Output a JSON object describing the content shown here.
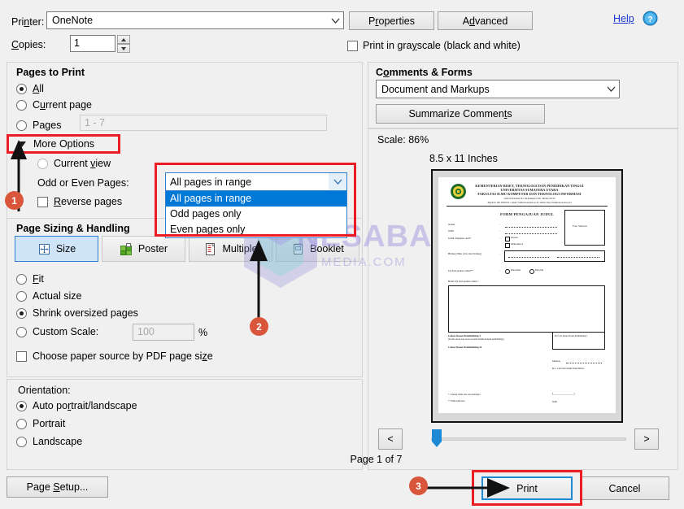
{
  "window": {
    "title": "Print"
  },
  "printer": {
    "label": "Printer:",
    "value": "OneNote",
    "properties_btn": "Properties",
    "advanced_btn": "Advanced",
    "help_link": "Help",
    "help_icon": "question-mark-icon"
  },
  "copies": {
    "label": "Copies:",
    "value": "1",
    "grayscale_label": "Print in grayscale (black and white)",
    "grayscale_checked": false
  },
  "pages_to_print": {
    "title": "Pages to Print",
    "options": [
      {
        "label": "All",
        "selected": true
      },
      {
        "label": "Current page",
        "selected": false
      },
      {
        "label": "Pages",
        "selected": false
      }
    ],
    "pages_range_placeholder": "1 - 7",
    "more_options_label": "More Options",
    "more_options_expanded": true,
    "current_view_label": "Current view",
    "current_view_selected": false,
    "odd_even_label": "Odd or Even Pages:",
    "odd_even_value": "All pages in range",
    "odd_even_options": [
      {
        "label": "All pages in range",
        "selected": true
      },
      {
        "label": "Odd pages only",
        "selected": false
      },
      {
        "label": "Even pages only",
        "selected": false
      }
    ],
    "reverse_pages_label": "Reverse pages",
    "reverse_pages_checked": false
  },
  "page_sizing": {
    "title": "Page Sizing & Handling",
    "tabs": [
      {
        "label": "Size",
        "icon": "resize-icon",
        "active": true
      },
      {
        "label": "Poster",
        "icon": "poster-grid-icon",
        "active": false
      },
      {
        "label": "Multiple",
        "icon": "multiple-pages-icon",
        "active": false
      },
      {
        "label": "Booklet",
        "icon": "booklet-icon",
        "active": false
      }
    ],
    "options": [
      {
        "label": "Fit",
        "selected": false
      },
      {
        "label": "Actual size",
        "selected": false
      },
      {
        "label": "Shrink oversized pages",
        "selected": true
      },
      {
        "label": "Custom Scale:",
        "selected": false
      }
    ],
    "custom_scale_value": "100",
    "percent_label": "%",
    "paper_source_label": "Choose paper source by PDF page size",
    "paper_source_checked": false
  },
  "orientation": {
    "title": "Orientation:",
    "options": [
      {
        "label": "Auto portrait/landscape",
        "selected": true
      },
      {
        "label": "Portrait",
        "selected": false
      },
      {
        "label": "Landscape",
        "selected": false
      }
    ]
  },
  "page_setup_btn": "Page Setup...",
  "comments_forms": {
    "title": "Comments & Forms",
    "value": "Document and Markups",
    "summarize_btn": "Summarize Comments"
  },
  "preview": {
    "scale_label": "Scale:  86%",
    "paper_size_label": "8.5 x 11 Inches",
    "prev_label": "<",
    "next_label": ">",
    "page_indicator": "Page 1 of 7",
    "document": {
      "header_line1": "KEMENTERIAN RISET, TEKNOLOGI DAN PENDIDIKAN TINGGI",
      "header_line2": "UNIVERSITAS SUMATERA UTARA",
      "header_line3": "FAKULTAS ILMU KOMPUTER DAN TEKNOLOGI INFORMASI",
      "header_address": "Jalan Universitas No. 9A Kampus USU, Medan 20155",
      "header_contact": "Telp/Fax: 061 8220161, e-mail: fasilkom-ti@usu.ac.id, laman: http://fasilkom-ti.usu.ac.id",
      "form_title": "FORM PENGAJUAN JUDUL",
      "photo_box_label": "Foto Terbaru",
      "fields": [
        "Nama",
        "NIM",
        "Judul diajukan oleh*",
        "Bidang Ilmu (wla dua bidang)",
        "Uji Kelayakan Judul**",
        "Hasil Uji Kelayakan Judul :"
      ],
      "checkboxes": [
        "Dosen",
        "Mahasiswa"
      ],
      "radios": [
        "Diterima",
        "Ditolak"
      ],
      "footer_left1": "Calon Dosen Pembimbing I",
      "footer_left2": "(Isi jika dosen atau dosen tersebut belum menjadi pembimbing)",
      "footer_left3": "Calon Dosen Pembimbing II",
      "footer_box": "Prof. Dr. Ketua Dosen Pembimbing I",
      "footer_right1": "Medan,",
      "footer_right2": "Ka. Laboratorium Penelitian,",
      "footer_note1": "* Centang salah satu atau keduanya",
      "footer_note2": "** Pilih salah satu",
      "footer_nip": "NIP."
    }
  },
  "actions": {
    "print_btn": "Print",
    "cancel_btn": "Cancel"
  },
  "annotations": {
    "markers": [
      {
        "id": "1",
        "value": "1"
      },
      {
        "id": "2",
        "value": "2"
      },
      {
        "id": "3",
        "value": "3"
      }
    ],
    "highlight_color": "#ec1c24",
    "marker_color": "#d9563a"
  },
  "watermark": {
    "text": "NESABA",
    "subtext": "MEDIA.COM"
  }
}
